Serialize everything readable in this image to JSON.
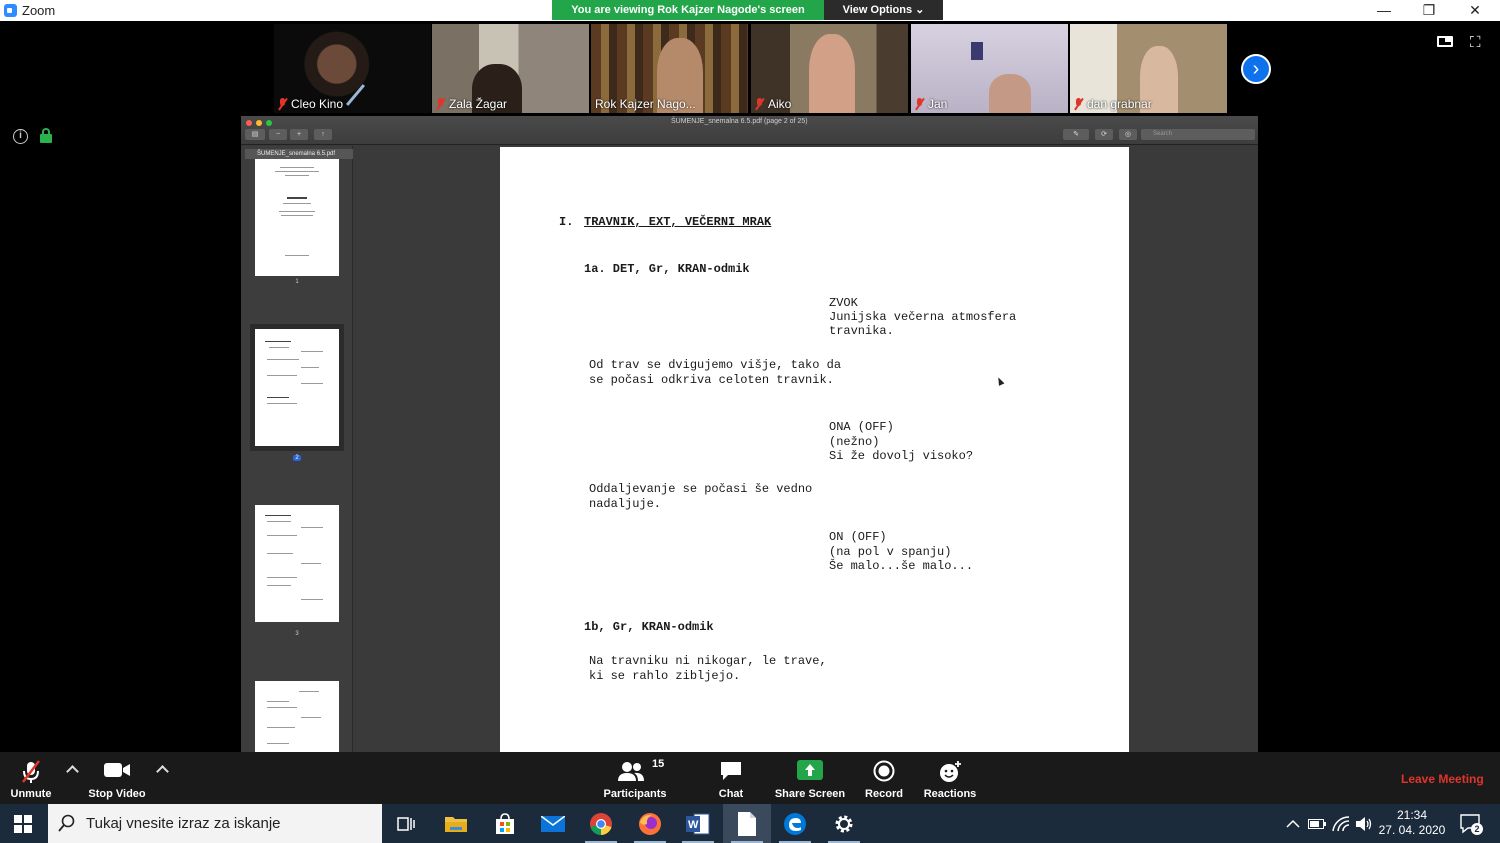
{
  "window": {
    "title": "Zoom",
    "minimize_glyph": "—",
    "restore_glyph": "❐",
    "close_glyph": "✕"
  },
  "share_banner": {
    "text": "You are viewing Rok Kajzer Nagode's screen",
    "view_options": "View Options"
  },
  "participants_strip": [
    {
      "name": "Cleo Kino",
      "muted": true
    },
    {
      "name": "Zala Žagar",
      "muted": true
    },
    {
      "name": "Rok Kajzer Nago...",
      "muted": false,
      "active": true
    },
    {
      "name": "Aiko",
      "muted": true
    },
    {
      "name": "Jan",
      "muted": true
    },
    {
      "name": "dan grabnar",
      "muted": true
    }
  ],
  "icons": {
    "next": "chevron-right-icon",
    "layout": "speaker-view-icon",
    "fullscreen": "fullscreen-icon",
    "info": "info-icon",
    "lock": "lock-icon"
  },
  "info_glyph": "i",
  "next_glyph": "›",
  "fullscreen_glyph": "⛶",
  "pdf_viewer": {
    "title": "ŠUMENJE_snemalna  6.5.pdf (page 2 of 25)",
    "sidebar_file": "ŠUMENJE_snemalna  6.5.pdf",
    "search_placeholder": "Search",
    "thumbnails": [
      {
        "page": "1",
        "selected": false
      },
      {
        "page": "2",
        "selected": true
      },
      {
        "page": "3",
        "selected": false
      },
      {
        "page": "4",
        "selected": false
      }
    ],
    "script": {
      "scene_heading": "I.  TRAVNIK, EXT, VEČERNI MRAK",
      "scene_number": "I.",
      "scene_title": "TRAVNIK, EXT, VEČERNI MRAK",
      "shot_1a": "1a. DET, Gr, KRAN-odmik",
      "zvok_label": "ZVOK",
      "zvok_line1": "Junijska večerna atmosfera",
      "zvok_line2": "travnika.",
      "action1_line1": "Od trav se dvigujemo višje, tako da",
      "action1_line2": "se počasi odkriva celoten travnik.",
      "ona_label": "ONA (OFF)",
      "ona_paren": "(nežno)",
      "ona_line": "Si že dovolj visoko?",
      "action2_line1": "Oddaljevanje se počasi še vedno",
      "action2_line2": "nadaljuje.",
      "on_label": "ON (OFF)",
      "on_paren": "(na pol v spanju)",
      "on_line": "Še malo...še malo...",
      "shot_1b": "1b, Gr, KRAN-odmik",
      "action3_line1": "Na travniku ni nikogar, le trave,",
      "action3_line2": "ki se rahlo zibljejo."
    }
  },
  "controls": {
    "unmute": "Unmute",
    "stop_video": "Stop Video",
    "participants": "Participants",
    "participants_count": "15",
    "chat": "Chat",
    "share_screen": "Share Screen",
    "record": "Record",
    "reactions": "Reactions",
    "leave": "Leave Meeting"
  },
  "taskbar": {
    "search_placeholder": "Tukaj vnesite izraz za iskanje",
    "time": "21:34",
    "date": "27. 04. 2020",
    "notification_count": "2",
    "apps": [
      "task-view-icon",
      "file-explorer-icon",
      "store-icon",
      "mail-icon",
      "chrome-icon",
      "firefox-icon",
      "word-icon",
      "document-icon",
      "edge-icon",
      "settings-icon"
    ]
  },
  "colors": {
    "share_green": "#23a64a",
    "zoom_blue": "#0e72ed",
    "muted_red": "#e0352b",
    "leave_red": "#e0352b",
    "active_speaker": "#76c043"
  }
}
